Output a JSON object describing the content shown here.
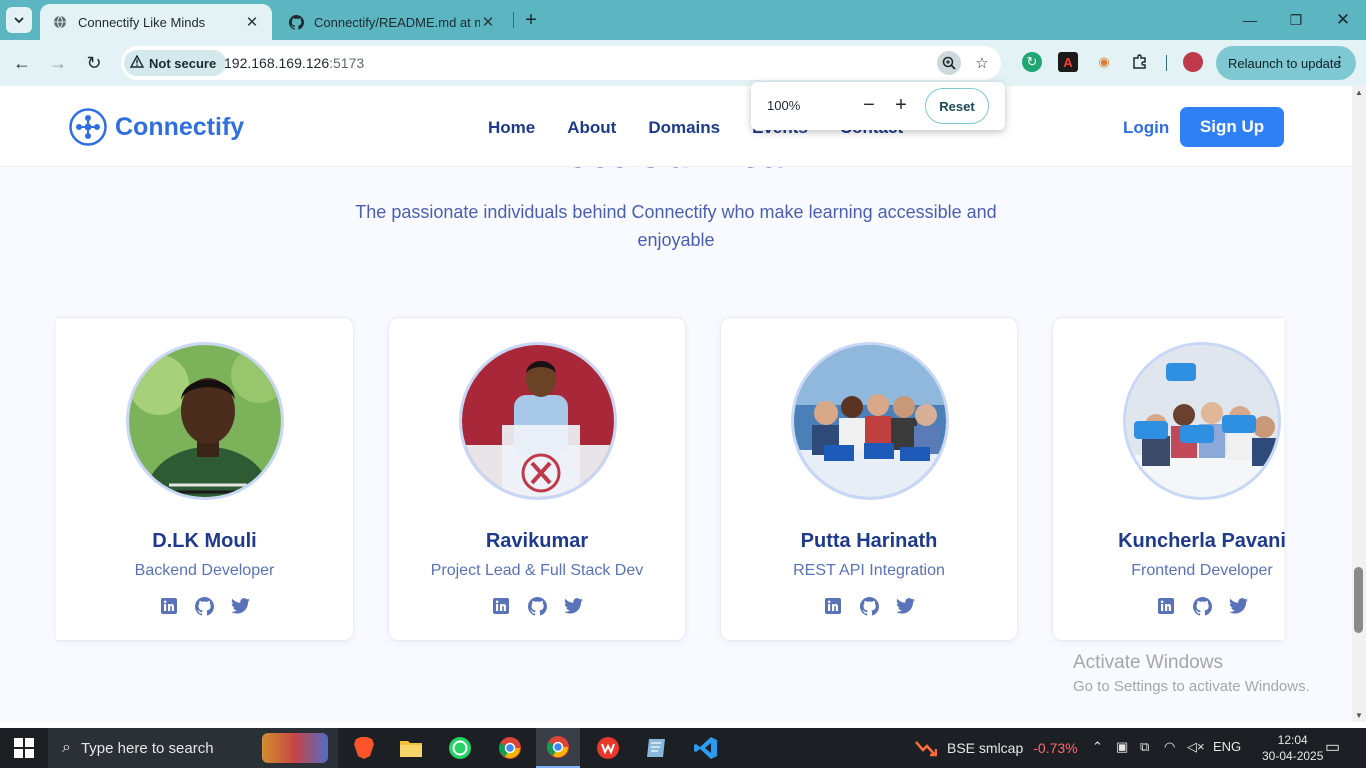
{
  "browser": {
    "tabs": [
      {
        "title": "Connectify Like Minds",
        "active": true
      },
      {
        "title": "Connectify/README.md at mai",
        "active": false
      }
    ],
    "address": {
      "security_label": "Not secure",
      "host": "192.168.169.126",
      "port": ":5173"
    },
    "relaunch_label": "Relaunch to update",
    "zoom": {
      "level": "100%",
      "reset_label": "Reset"
    }
  },
  "site": {
    "brand": "Connectify",
    "nav": [
      "Home",
      "About",
      "Domains",
      "Events",
      "Contact"
    ],
    "login_label": "Login",
    "signup_label": "Sign Up"
  },
  "team": {
    "title": "Meet Our Team",
    "subtitle": "The passionate individuals behind Connectify who make learning accessible and enjoyable",
    "members": [
      {
        "name": "D.LK Mouli",
        "role": "Backend Developer"
      },
      {
        "name": "Ravikumar",
        "role": "Project Lead & Full Stack Dev"
      },
      {
        "name": "Putta Harinath",
        "role": "REST API Integration"
      },
      {
        "name": "Kuncherla Pavani",
        "role": "Frontend Developer"
      }
    ],
    "social_icons": [
      "linkedin-icon",
      "github-icon",
      "twitter-icon"
    ]
  },
  "watermark": {
    "line1": "Activate Windows",
    "line2": "Go to Settings to activate Windows."
  },
  "taskbar": {
    "search_placeholder": "Type here to search",
    "stock_name": "BSE smlcap",
    "stock_change": "-0.73%",
    "language": "ENG",
    "time": "12:04",
    "date": "30-04-2025"
  },
  "colors": {
    "brand": "#2f6fe0",
    "heading": "#1e3a8a",
    "chrome": "#5bb6c1"
  }
}
